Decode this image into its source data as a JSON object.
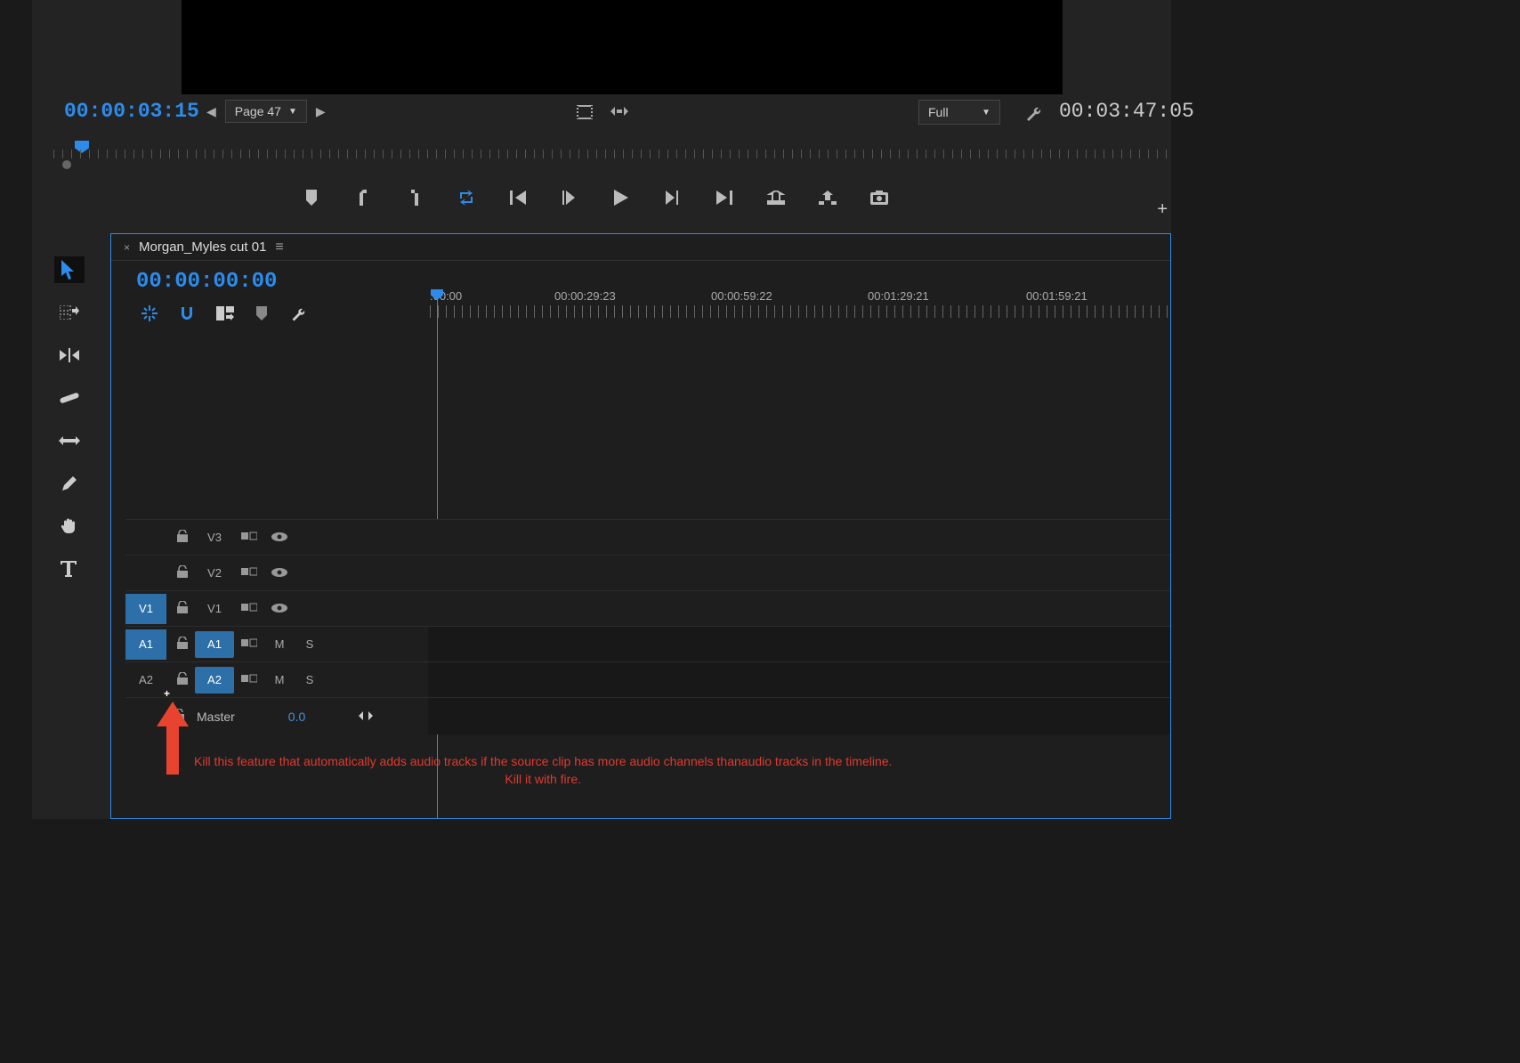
{
  "monitor": {
    "timecode_left": "00:00:03:15",
    "page_label": "Page 47",
    "resolution": "Full",
    "timecode_right": "00:03:47:05"
  },
  "timeline": {
    "tab_name": "Morgan_Myles cut 01",
    "timecode": "00:00:00:00",
    "ruler_labels": [
      ":00:00",
      "00:00:29:23",
      "00:00:59:22",
      "00:01:29:21",
      "00:01:59:21"
    ],
    "tracks": {
      "v3": {
        "label": "V3"
      },
      "v2": {
        "label": "V2"
      },
      "v1": {
        "src": "V1",
        "label": "V1"
      },
      "a1": {
        "src": "A1",
        "label": "A1",
        "m": "M",
        "s": "S"
      },
      "a2": {
        "src": "A2",
        "label": "A2",
        "m": "M",
        "s": "S"
      },
      "master": {
        "label": "Master",
        "value": "0.0"
      }
    }
  },
  "annotation": {
    "line1": "Kill this feature that automatically adds audio tracks if the source clip has more audio channels thanaudio tracks in the timeline.",
    "line2": "Kill it with fire."
  }
}
